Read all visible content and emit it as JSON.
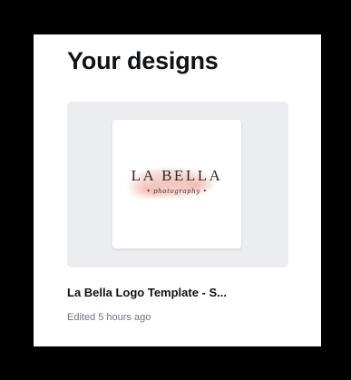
{
  "section": {
    "title": "Your designs"
  },
  "designs": [
    {
      "title": "La Bella Logo Template - S...",
      "edited": "Edited 5 hours ago",
      "thumbnail": {
        "wordmark": "LA BELLA",
        "script": "• photography •",
        "accent_color": "#f2b9ae"
      }
    }
  ],
  "colors": {
    "background": "#000000",
    "panel": "#ffffff",
    "thumbnail_frame": "#ebedf1",
    "text_primary": "#0e1318",
    "text_secondary": "#6b7280"
  }
}
